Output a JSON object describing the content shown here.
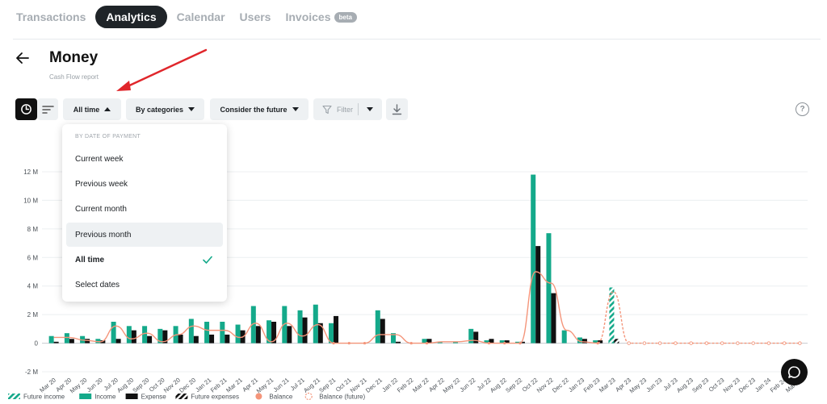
{
  "nav": {
    "tabs": [
      "Transactions",
      "Analytics",
      "Calendar",
      "Users",
      "Invoices"
    ],
    "active": "Analytics",
    "beta_badge": "beta"
  },
  "header": {
    "title": "Money",
    "subtitle": "Cash Flow report"
  },
  "toolbar": {
    "period": "All time",
    "grouping": "By categories",
    "future": "Consider the future",
    "filter": "Filter"
  },
  "dropdown": {
    "header": "BY DATE OF PAYMENT",
    "items": [
      "Current week",
      "Previous week",
      "Current month",
      "Previous month",
      "All time",
      "Select dates"
    ],
    "hovered": "Previous month",
    "selected": "All time"
  },
  "colors": {
    "income": "#14a98a",
    "expense": "#111111",
    "balance": "#f4957a",
    "accent": "#1f2428",
    "arrow": "#e0262b"
  },
  "chart_data": {
    "type": "bar",
    "ylim": [
      -2,
      12
    ],
    "yticks": [
      "12 M",
      "10 M",
      "8 M",
      "6 M",
      "4 M",
      "2 M",
      "0",
      "-2 M"
    ],
    "categories": [
      "Mar 20",
      "Apr 20",
      "May 20",
      "Jun 20",
      "Jul 20",
      "Aug 20",
      "Sep 20",
      "Oct 20",
      "Nov 20",
      "Dec 20",
      "Jan 21",
      "Feb 21",
      "Mar 21",
      "Apr 21",
      "May 21",
      "Jun 21",
      "Jul 21",
      "Aug 21",
      "Sep 21",
      "Oct 21",
      "Nov 21",
      "Dec 21",
      "Jan 22",
      "Feb 22",
      "Mar 22",
      "Apr 22",
      "May 22",
      "Jun 22",
      "Jul 22",
      "Aug 22",
      "Sep 22",
      "Oct 22",
      "Nov 22",
      "Dec 22",
      "Jan 23",
      "Feb 23",
      "Mar 23",
      "Apr 23",
      "May 23",
      "Jun 23",
      "Jul 23",
      "Aug 23",
      "Sep 23",
      "Oct 23",
      "Nov 23",
      "Dec 23",
      "Jan 24",
      "Feb 24",
      "Mar 24"
    ],
    "xlabels_shown": [
      "Mar 20",
      "May 20",
      "Jul 20",
      "Sep 20",
      "Nov 20",
      "Jan 21",
      "Mar 21",
      "May 21",
      "Jul 21",
      "Sep 21",
      "Nov 21",
      "Jan 22",
      "Mar 22",
      "May 22",
      "Jul 22",
      "Sep 22",
      "Nov 22",
      "Jan 23",
      "Mar 23",
      "May 23",
      "Jul 23",
      "Sep 23",
      "Nov 23",
      "Jan 24",
      "Mar 24"
    ],
    "xlabels_mid": [
      "Apr 20",
      "Jun 20",
      "Aug 20",
      "Oct 20",
      "Dec 20",
      "Feb 21",
      "Apr 21",
      "Jun 21",
      "Aug 21",
      "Oct 21",
      "Dec 21",
      "Feb 22",
      "Apr 22",
      "Jun 22",
      "Aug 22",
      "Oct 22",
      "Dec 22",
      "Feb 23",
      "Apr 23",
      "Jun 23",
      "Aug 23",
      "Oct 23",
      "Dec 23",
      "Feb 24"
    ],
    "series": [
      {
        "name": "Income",
        "values": [
          0.5,
          0.7,
          0.5,
          0.3,
          1.5,
          1.2,
          1.2,
          1.0,
          1.2,
          1.7,
          1.5,
          1.5,
          1.3,
          2.6,
          1.6,
          2.6,
          2.3,
          2.7,
          1.4,
          0,
          0,
          2.3,
          0.7,
          0,
          0.3,
          0.1,
          0.1,
          1.0,
          0.2,
          0.2,
          0.1,
          11.8,
          7.7,
          0.9,
          0.4,
          0.2,
          0.2,
          0,
          0,
          0,
          0,
          0,
          0,
          0,
          0,
          0,
          0,
          0,
          0
        ]
      },
      {
        "name": "Expense",
        "values": [
          0.1,
          0.3,
          0.3,
          0.2,
          0.3,
          0.9,
          0.5,
          0.9,
          0.6,
          0.5,
          0.6,
          0.6,
          0.9,
          1.2,
          1.5,
          1.2,
          1.8,
          1.4,
          1.9,
          0,
          0,
          1.7,
          0.1,
          0,
          0.3,
          0,
          0,
          0.8,
          0.3,
          0.2,
          0.1,
          6.8,
          3.5,
          0,
          0.3,
          0.2,
          0.2,
          0,
          0,
          0,
          0,
          0,
          0,
          0,
          0,
          0,
          0,
          0,
          0
        ]
      },
      {
        "name": "Future income",
        "values": [
          0,
          0,
          0,
          0,
          0,
          0,
          0,
          0,
          0,
          0,
          0,
          0,
          0,
          0,
          0,
          0,
          0,
          0,
          0,
          0,
          0,
          0,
          0,
          0,
          0,
          0,
          0,
          0,
          0,
          0,
          0,
          0,
          0,
          0,
          0,
          0,
          3.9,
          0,
          0,
          0,
          0,
          0,
          0,
          0,
          0,
          0,
          0,
          0,
          0
        ]
      },
      {
        "name": "Future expenses",
        "values": [
          0,
          0,
          0,
          0,
          0,
          0,
          0,
          0,
          0,
          0,
          0,
          0,
          0,
          0,
          0,
          0,
          0,
          0,
          0,
          0,
          0,
          0,
          0,
          0,
          0,
          0,
          0,
          0,
          0,
          0,
          0,
          0,
          0,
          0,
          0,
          0,
          0.3,
          0,
          0,
          0,
          0,
          0,
          0,
          0,
          0,
          0,
          0,
          0,
          0
        ]
      },
      {
        "name": "Balance",
        "values": [
          0.4,
          0.4,
          0.2,
          0.1,
          1.2,
          0.3,
          0.7,
          0.1,
          0.6,
          1.2,
          0.9,
          0.9,
          0.4,
          1.4,
          0.1,
          1.4,
          0.5,
          1.3,
          0,
          0,
          0,
          0.6,
          0.6,
          0,
          0,
          0.1,
          0.1,
          0.2,
          0,
          0,
          0,
          5.0,
          4.2,
          0.9,
          0.1,
          0,
          0,
          0,
          0,
          0,
          0,
          0,
          0,
          0,
          0,
          0,
          0,
          0,
          0
        ]
      },
      {
        "name": "Balance (future)",
        "values": [
          0,
          0,
          0,
          0,
          0,
          0,
          0,
          0,
          0,
          0,
          0,
          0,
          0,
          0,
          0,
          0,
          0,
          0,
          0,
          0,
          0,
          0,
          0,
          0,
          0,
          0,
          0,
          0,
          0,
          0,
          0,
          0,
          0,
          0,
          0,
          0,
          3.6,
          0,
          0,
          0,
          0,
          0,
          0,
          0,
          0,
          0,
          0,
          0,
          0
        ]
      }
    ],
    "legend": [
      {
        "name": "Future income",
        "kind": "striped-income"
      },
      {
        "name": "Income",
        "kind": "income"
      },
      {
        "name": "Expense",
        "kind": "expense"
      },
      {
        "name": "Future expenses",
        "kind": "striped-expense"
      },
      {
        "name": "Balance",
        "kind": "balance"
      },
      {
        "name": "Balance (future)",
        "kind": "balance-future"
      }
    ],
    "legend_placement": "bottom-left",
    "grid": true
  }
}
